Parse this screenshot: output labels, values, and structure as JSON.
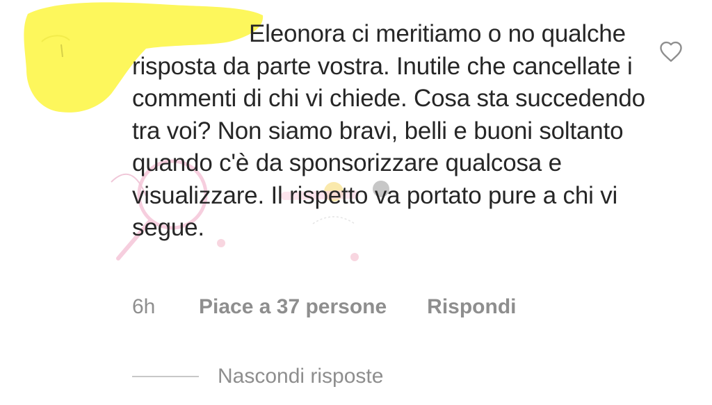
{
  "comment": {
    "username": "",
    "text": "Eleonora ci meritiamo o no qualche risposta da parte vostra. Inutile che cancellate i commenti di chi vi chiede. Cosa sta succedendo tra voi? Non siamo bravi, belli e buoni soltanto quando c'è da sponsorizzare qualcosa e visualizzare. Il rispetto va portato pure a chi vi segue.",
    "time": "6h",
    "likes_label": "Piace a 37 persone",
    "reply_label": "Rispondi"
  },
  "replies": {
    "toggle_label": "Nascondi risposte"
  },
  "icons": {
    "like": "heart-outline-icon"
  },
  "colors": {
    "text": "#262626",
    "secondary": "#8e8e8e",
    "scribble": "#fdf75c"
  }
}
